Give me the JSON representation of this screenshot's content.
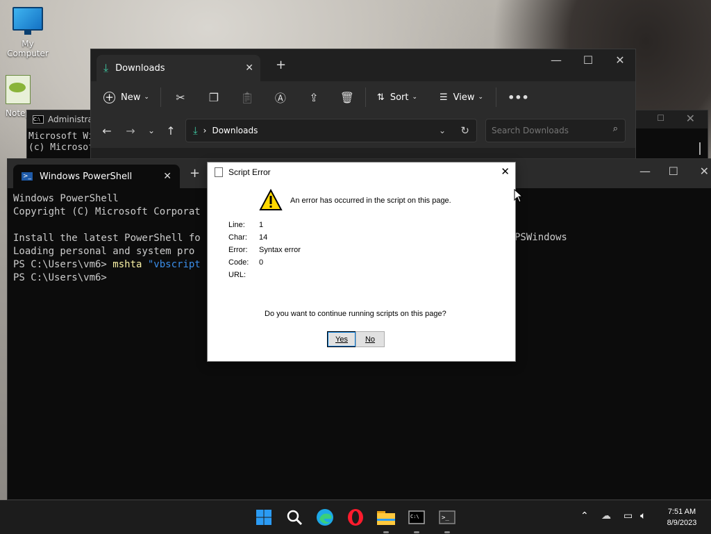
{
  "desktop": {
    "icons": [
      {
        "label": "My Computer",
        "icon": "computer-icon"
      },
      {
        "label": "Notep",
        "icon": "notepad-icon"
      }
    ]
  },
  "admin_cmd": {
    "title": "Administrat",
    "lines": [
      "Microsoft Wi",
      "(c) Microsof"
    ]
  },
  "explorer": {
    "tab_label": "Downloads",
    "toolbar": {
      "new_label": "New",
      "sort_label": "Sort",
      "view_label": "View"
    },
    "address_crumb": "Downloads",
    "search_placeholder": "Search Downloads"
  },
  "powershell": {
    "tab_label": "Windows PowerShell",
    "lines": {
      "l1": "Windows PowerShell",
      "l2": "Copyright (C) Microsoft Corporat",
      "l3a": "Install the latest PowerShell fo",
      "l3b": "PSWindows",
      "l4": "Loading personal and system pro",
      "l5_prompt": "PS C:\\Users\\vm6> ",
      "l5_cmd": "mshta ",
      "l5_arg": "\"vbscript",
      "l6": "PS C:\\Users\\vm6>"
    }
  },
  "dialog": {
    "title": "Script Error",
    "message": "An error has occurred in the script on this page.",
    "fields": {
      "line_label": "Line:",
      "line_value": "1",
      "char_label": "Char:",
      "char_value": "14",
      "error_label": "Error:",
      "error_value": "Syntax error",
      "code_label": "Code:",
      "code_value": "0",
      "url_label": "URL:",
      "url_value": ""
    },
    "question": "Do you want to continue running scripts on this page?",
    "yes_label": "Yes",
    "no_label": "No"
  },
  "taskbar": {
    "apps": [
      "start-icon",
      "search-icon",
      "edge-icon",
      "opera-icon",
      "file-explorer-icon",
      "cmd-icon",
      "terminal-icon"
    ],
    "time": "7:51 AM",
    "date": "8/9/2023"
  },
  "colors": {
    "accent": "#0078d4",
    "console_yellow": "#f9f1a5",
    "console_blue": "#3b8eea"
  }
}
